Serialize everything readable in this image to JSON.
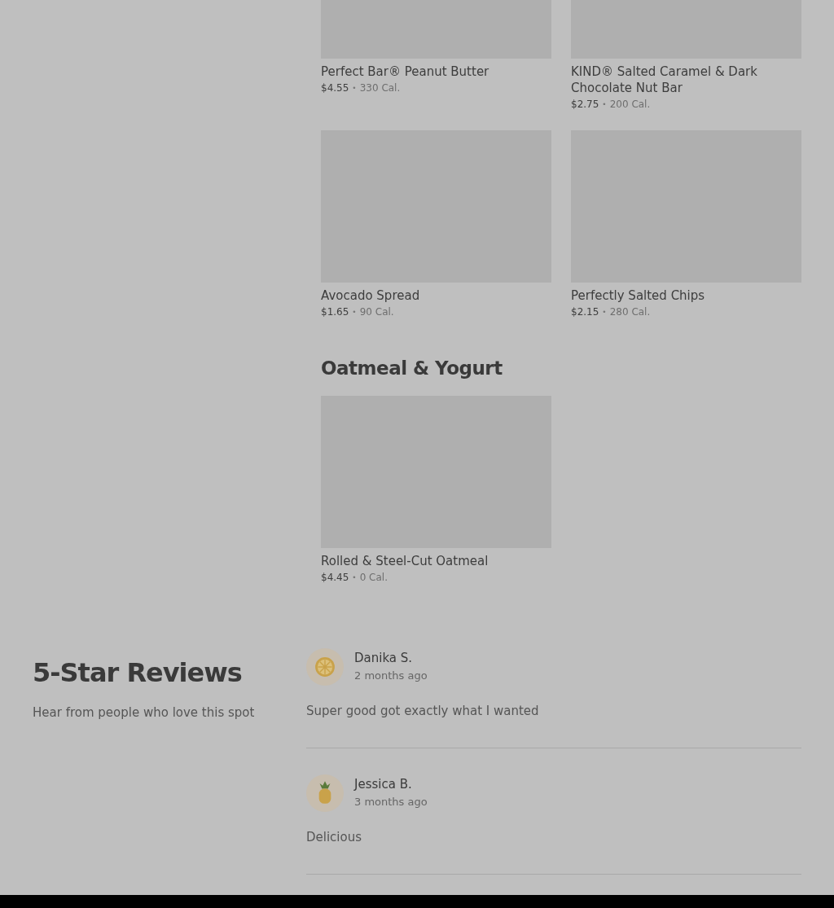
{
  "menu_sections": [
    {
      "items": [
        {
          "name": "Perfect Bar® Peanut Butter",
          "price": "$4.55",
          "calories": "330 Cal."
        },
        {
          "name": "KIND® Salted Caramel & Dark Chocolate Nut Bar",
          "price": "$2.75",
          "calories": "200 Cal."
        },
        {
          "name": "Avocado Spread",
          "price": "$1.65",
          "calories": "90 Cal."
        },
        {
          "name": "Perfectly Salted Chips",
          "price": "$2.15",
          "calories": "280 Cal."
        }
      ]
    },
    {
      "title": "Oatmeal & Yogurt",
      "items": [
        {
          "name": "Rolled & Steel-Cut Oatmeal",
          "price": "$4.45",
          "calories": "0 Cal."
        }
      ]
    }
  ],
  "separator": "•",
  "reviews": {
    "title": "5-Star Reviews",
    "subtitle": "Hear from people who love this spot",
    "items": [
      {
        "kind": "orange",
        "name": "Danika S.",
        "time": "2 months ago",
        "text": "Super good got exactly what I wanted"
      },
      {
        "kind": "pineapple",
        "name": "Jessica B.",
        "time": "3 months ago",
        "text": "Delicious"
      }
    ]
  }
}
